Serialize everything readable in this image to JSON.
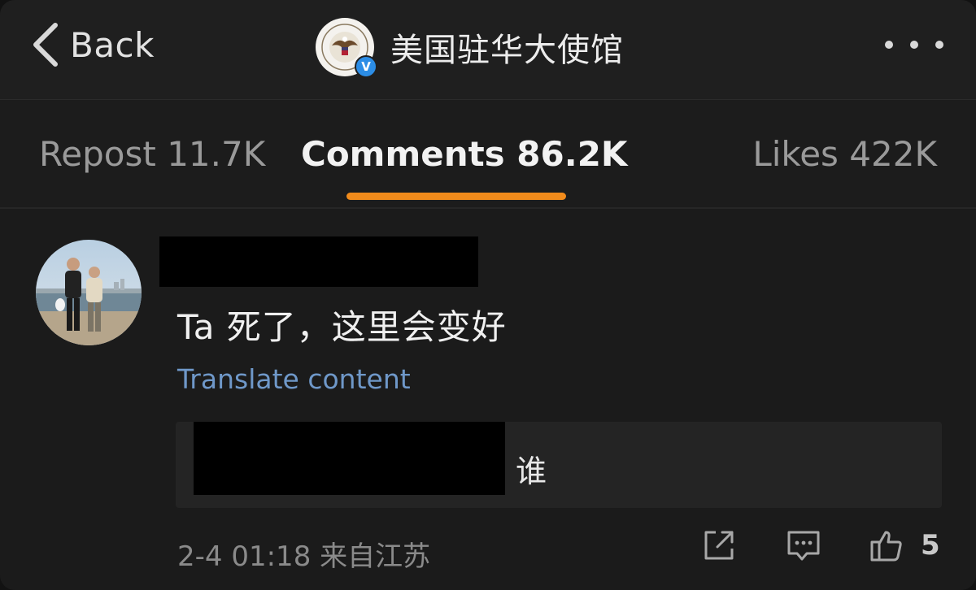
{
  "navbar": {
    "back_label": "Back",
    "account_name": "美国驻华大使馆",
    "verified_mark": "V"
  },
  "tabs": [
    {
      "label": "Repost 11.7K",
      "active": false
    },
    {
      "label": "Comments 86.2K",
      "active": true
    },
    {
      "label": "Likes 422K",
      "active": false
    }
  ],
  "comment": {
    "text": "Ta 死了，这里会变好",
    "translate_label": "Translate content",
    "reply_text": "谁",
    "timestamp": "2-4 01:18",
    "location": "来自江苏",
    "like_count": "5"
  },
  "icons": {
    "back": "chevron-left-icon",
    "more": "more-dots-icon",
    "share": "share-icon",
    "reply": "comment-icon",
    "like": "thumbs-up-icon"
  },
  "colors": {
    "accent": "#f18b1b",
    "link": "#6f98c9",
    "verified": "#2c8de6",
    "background": "#1b1b1b"
  }
}
